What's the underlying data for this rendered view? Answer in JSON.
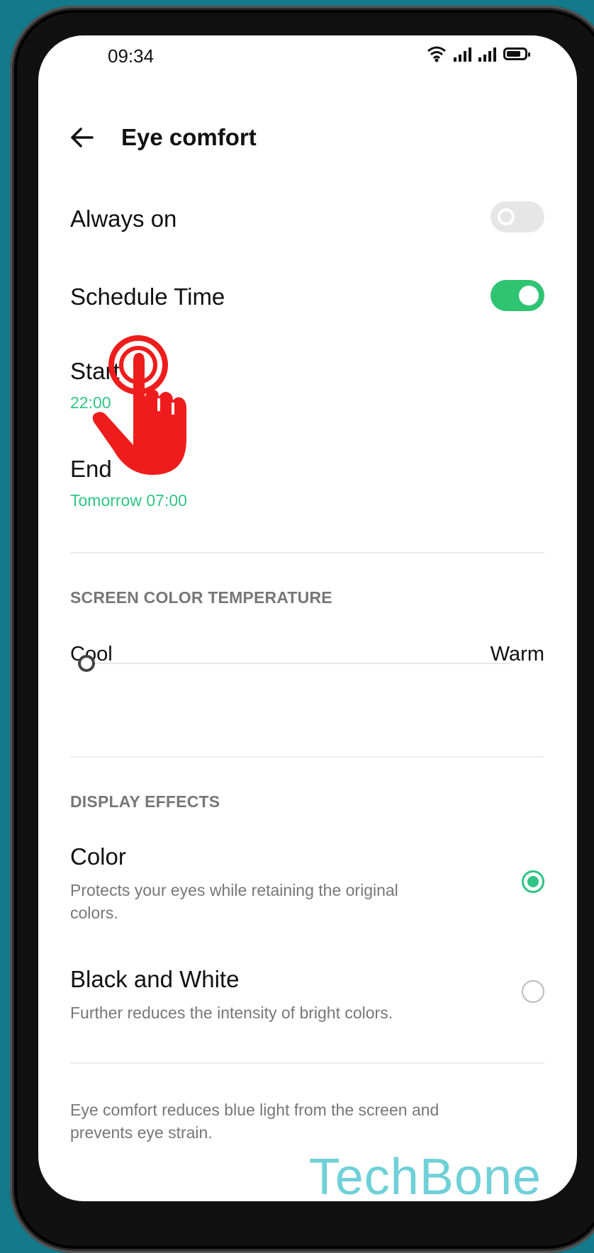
{
  "status_bar": {
    "time": "09:34"
  },
  "header": {
    "title": "Eye comfort"
  },
  "settings": {
    "always_on": {
      "label": "Always on",
      "enabled": false
    },
    "schedule_time": {
      "label": "Schedule Time",
      "enabled": true
    },
    "start": {
      "label": "Start",
      "value": "22:00"
    },
    "end": {
      "label": "End",
      "value": "Tomorrow 07:00"
    }
  },
  "color_temperature": {
    "section_title": "SCREEN COLOR TEMPERATURE",
    "min_label": "Cool",
    "max_label": "Warm",
    "value_fraction": 0.0
  },
  "display_effects": {
    "section_title": "DISPLAY EFFECTS",
    "options": [
      {
        "title": "Color",
        "description": "Protects your eyes while retaining the original colors.",
        "selected": true
      },
      {
        "title": "Black and White",
        "description": "Further reduces the intensity of bright colors.",
        "selected": false
      }
    ]
  },
  "footer_note": "Eye comfort reduces blue light from the screen and prevents eye strain.",
  "watermark": "TechBone",
  "colors": {
    "accent": "#2fc484",
    "background": "#137a8c",
    "tap_hand": "#ee1c1c"
  }
}
